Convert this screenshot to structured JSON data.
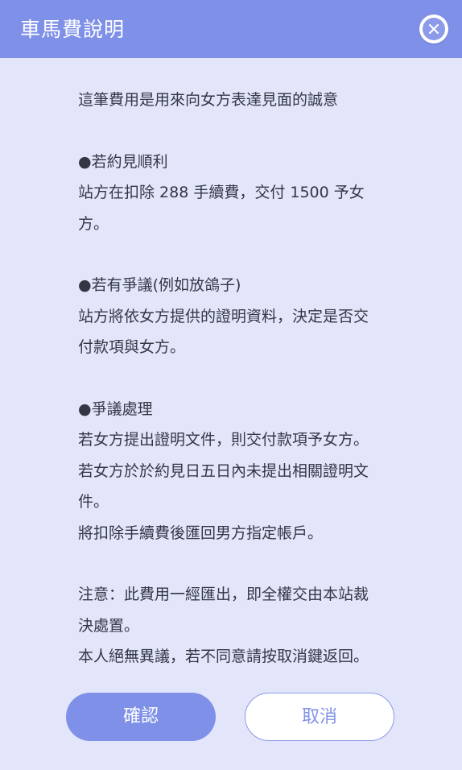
{
  "dialog": {
    "title": "車馬費說明",
    "close_icon": "close-icon",
    "accent_color": "#7f90e8",
    "body_lines": [
      "這筆費用是用來向女方表達見面的誠意",
      "",
      "●若約見順利",
      "站方在扣除 288 手續費，交付 1500 予女",
      "方。",
      "",
      "●若有爭議(例如放鴿子)",
      "站方將依女方提供的證明資料，決定是否交",
      "付款項與女方。",
      "",
      "●爭議處理",
      "若女方提出證明文件，則交付款項予女方。",
      "若女方於於約見日五日內未提出相關證明文",
      "件。",
      "將扣除手續費後匯回男方指定帳戶。",
      "",
      "注意：此費用一經匯出，即全權交由本站裁",
      "決處置。",
      "本人絕無異議，若不同意請按取消鍵返回。"
    ],
    "confirm_label": "確認",
    "cancel_label": "取消"
  }
}
